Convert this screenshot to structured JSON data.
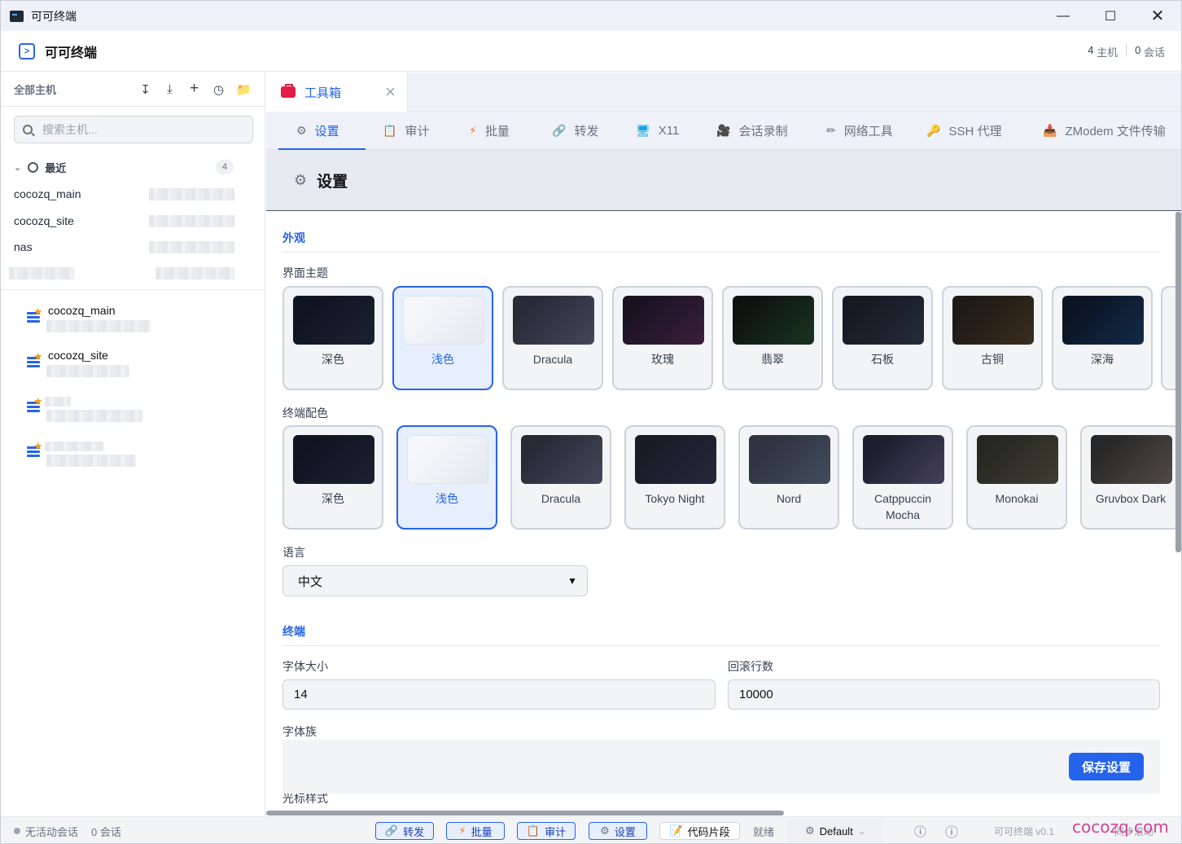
{
  "window": {
    "title": "可可终端"
  },
  "header": {
    "brand": "可可终端",
    "hosts_count": "4",
    "hosts_label": "主机",
    "sessions_count": "0",
    "sessions_label": "会话"
  },
  "sidebar": {
    "title": "全部主机",
    "search_placeholder": "搜索主机...",
    "recent_label": "最近",
    "recent_count": "4",
    "recent": [
      "cocozq_main",
      "cocozq_site",
      "nas",
      ""
    ],
    "hosts": [
      "cocozq_main",
      "cocozq_site",
      "",
      ""
    ]
  },
  "tab": {
    "label": "工具箱"
  },
  "subtabs": [
    {
      "label": "设置",
      "icon": "gear-icon"
    },
    {
      "label": "审计",
      "icon": "clipboard-icon"
    },
    {
      "label": "批量",
      "icon": "lightning-icon"
    },
    {
      "label": "转发",
      "icon": "link-icon"
    },
    {
      "label": "X11",
      "icon": "monitor-icon"
    },
    {
      "label": "会话录制",
      "icon": "camera-icon"
    },
    {
      "label": "网络工具",
      "icon": "pen-icon"
    },
    {
      "label": "SSH 代理",
      "icon": "key-icon"
    },
    {
      "label": "ZModem 文件传输",
      "icon": "upload-icon"
    }
  ],
  "panel": {
    "title": "设置"
  },
  "appearance": {
    "section": "外观",
    "ui_theme_label": "界面主题",
    "ui_themes": [
      {
        "name": "深色",
        "c1": "#0f1520",
        "c2": "#1a2130"
      },
      {
        "name": "浅色",
        "c1": "#f5f7fa",
        "c2": "#e4e8ee",
        "selected": true
      },
      {
        "name": "Dracula",
        "c1": "#282a36",
        "c2": "#44475a"
      },
      {
        "name": "玫瑰",
        "c1": "#1a1322",
        "c2": "#3a1f3a"
      },
      {
        "name": "翡翠",
        "c1": "#0c1410",
        "c2": "#1b3322"
      },
      {
        "name": "石板",
        "c1": "#141922",
        "c2": "#252c38"
      },
      {
        "name": "古铜",
        "c1": "#1e1a15",
        "c2": "#3a2d1e"
      },
      {
        "name": "深海",
        "c1": "#0b1422",
        "c2": "#132a48"
      }
    ],
    "term_colors_label": "终端配色",
    "term_colors": [
      {
        "name": "深色",
        "c1": "#0f1520",
        "c2": "#1a2130"
      },
      {
        "name": "浅色",
        "c1": "#f5f7fa",
        "c2": "#e4e8ee",
        "selected": true
      },
      {
        "name": "Dracula",
        "c1": "#282a36",
        "c2": "#44475a"
      },
      {
        "name": "Tokyo Night",
        "c1": "#1a1b26",
        "c2": "#24283b"
      },
      {
        "name": "Nord",
        "c1": "#2e3440",
        "c2": "#434c5e"
      },
      {
        "name": "Catppuccin Mocha",
        "c1": "#1e1e2e",
        "c2": "#45405a"
      },
      {
        "name": "Monokai",
        "c1": "#272822",
        "c2": "#3e3d32"
      },
      {
        "name": "Gruvbox Dark",
        "c1": "#282828",
        "c2": "#504945"
      }
    ],
    "language_label": "语言",
    "language_value": "中文"
  },
  "terminal": {
    "section": "终端",
    "font_size_label": "字体大小",
    "font_size": "14",
    "scrollback_label": "回滚行数",
    "scrollback": "10000",
    "font_family_label": "字体族",
    "cursor_label": "光标样式"
  },
  "save_label": "保存设置",
  "status": {
    "no_session": "无活动会话",
    "sessions": "0 会话",
    "btn_forward": "转发",
    "btn_batch": "批量",
    "btn_audit": "审计",
    "btn_settings": "设置",
    "btn_snippets": "代码片段",
    "ready": "就绪",
    "profile": "Default",
    "version": "可可终端 v0.1",
    "sync": "同步滚动"
  },
  "watermark": "cocozq.com",
  "colors": {
    "accent": "#2563eb",
    "danger": "#e11d48"
  }
}
